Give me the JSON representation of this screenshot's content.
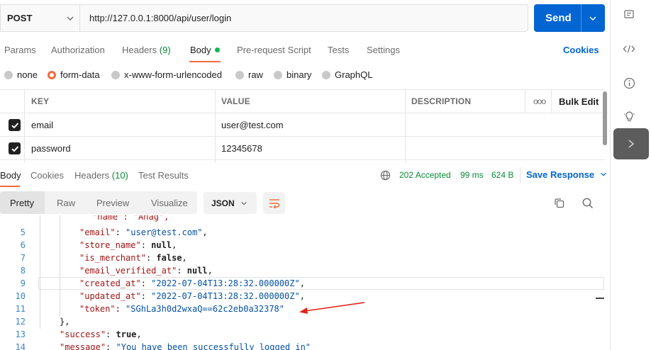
{
  "request": {
    "method": "POST",
    "url": "http://127.0.0.1:8000/api/user/login",
    "send_label": "Send"
  },
  "request_tabs": [
    {
      "label": "Params"
    },
    {
      "label": "Authorization"
    },
    {
      "label": "Headers",
      "count": "(9)"
    },
    {
      "label": "Body",
      "active": true
    },
    {
      "label": "Pre-request Script"
    },
    {
      "label": "Tests"
    },
    {
      "label": "Settings"
    }
  ],
  "cookies_label": "Cookies",
  "body_types": [
    {
      "label": "none"
    },
    {
      "label": "form-data",
      "selected": true
    },
    {
      "label": "x-www-form-urlencoded"
    },
    {
      "label": "raw"
    },
    {
      "label": "binary"
    },
    {
      "label": "GraphQL"
    }
  ],
  "form_table": {
    "headers": {
      "key": "KEY",
      "value": "VALUE",
      "description": "DESCRIPTION",
      "more": "ooo",
      "bulk_edit": "Bulk Edit"
    },
    "rows": [
      {
        "checked": true,
        "key": "email",
        "value": "user@test.com",
        "description": ""
      },
      {
        "checked": true,
        "key": "password",
        "value": "12345678",
        "description": ""
      }
    ]
  },
  "response_tabs": [
    {
      "label": "Body",
      "active": true
    },
    {
      "label": "Cookies"
    },
    {
      "label": "Headers",
      "count": "(10)"
    },
    {
      "label": "Test Results"
    }
  ],
  "response_status": {
    "status": "202 Accepted",
    "time": "99 ms",
    "size": "624 B",
    "save_label": "Save Response"
  },
  "view_modes": [
    {
      "label": "Pretty",
      "active": true
    },
    {
      "label": "Raw"
    },
    {
      "label": "Preview"
    },
    {
      "label": "Visualize"
    }
  ],
  "format_select": "JSON",
  "code": {
    "partial_top": "\"name\": \"Anag\",",
    "lines": [
      {
        "n": "5",
        "key": "email",
        "value": "\"user@test.com\"",
        "type": "string"
      },
      {
        "n": "6",
        "key": "store_name",
        "value": "null",
        "type": "keyword"
      },
      {
        "n": "7",
        "key": "is_merchant",
        "value": "false",
        "type": "keyword"
      },
      {
        "n": "8",
        "key": "email_verified_at",
        "value": "null",
        "type": "keyword"
      },
      {
        "n": "9",
        "key": "created_at",
        "value": "\"2022-07-04T13:28:32.000000Z\"",
        "type": "string"
      },
      {
        "n": "10",
        "key": "updated_at",
        "value": "\"2022-07-04T13:28:32.000000Z\"",
        "type": "string"
      },
      {
        "n": "11",
        "key": "token",
        "value": "\"SGhLa3h0d2wxaQ==62c2eb0a32378\"",
        "type": "string"
      },
      {
        "n": "12",
        "text": "},"
      },
      {
        "n": "13",
        "key": "success",
        "value": "true",
        "type": "keyword"
      },
      {
        "n": "14",
        "key": "message",
        "value": "\"You have been successfully logged in\"",
        "type": "string"
      }
    ]
  },
  "colors": {
    "accent_orange": "#f26b3a",
    "primary_blue": "#0265d2",
    "status_green": "#0a8a3a",
    "annotation_arrow": "#e0251b"
  }
}
